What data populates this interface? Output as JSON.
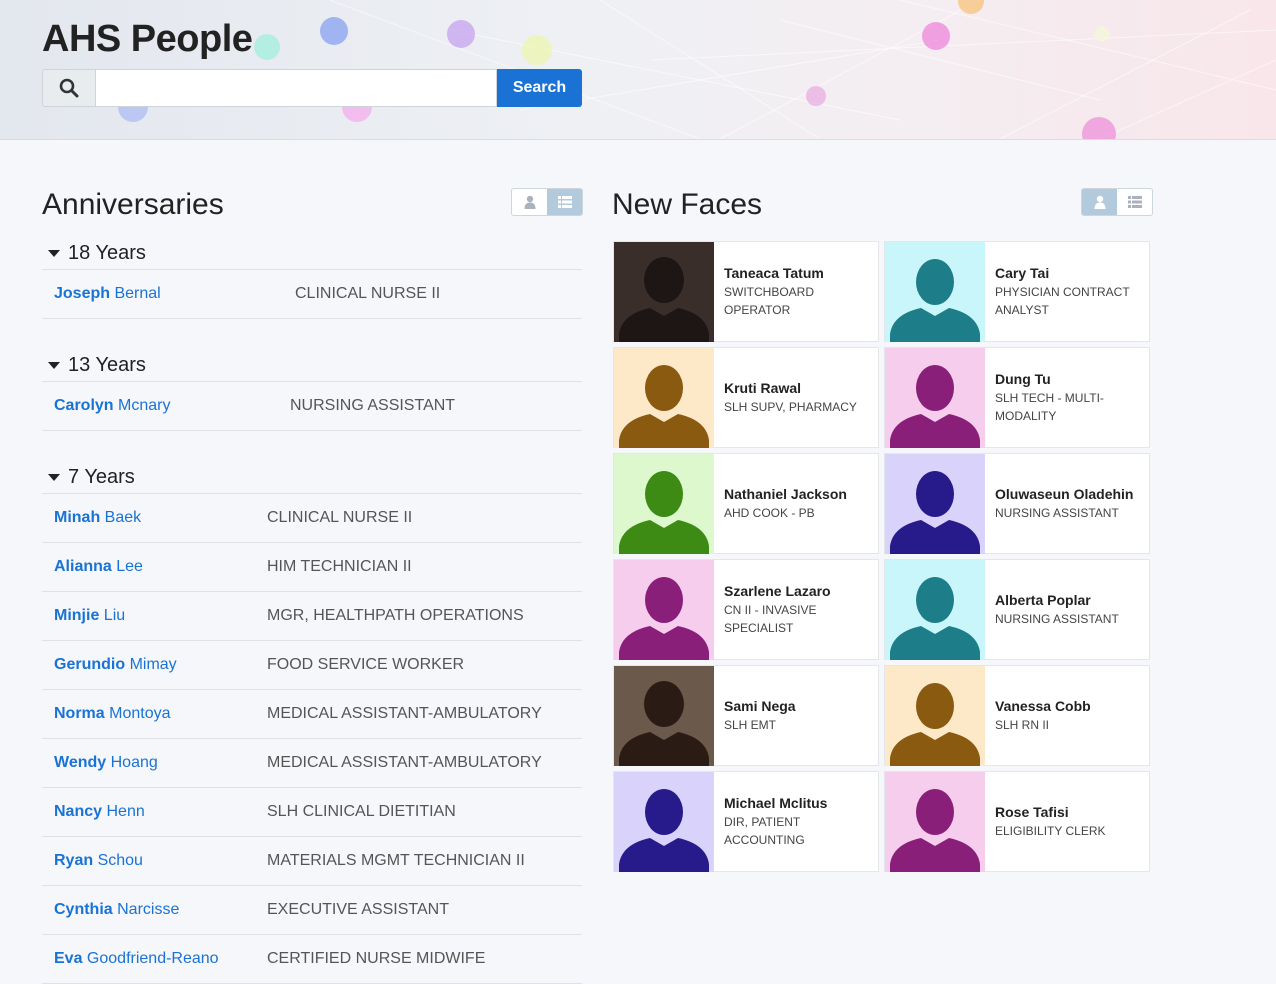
{
  "app": {
    "title": "AHS People",
    "search": {
      "placeholder": "",
      "value": "",
      "button_label": "Search",
      "icon": "search-icon"
    }
  },
  "anniversaries": {
    "title": "Anniversaries",
    "view_toggle": {
      "options": [
        "person-icon",
        "list-icon"
      ],
      "active": "list-icon"
    },
    "groups": [
      {
        "label": "18 Years",
        "people": [
          {
            "first": "Joseph",
            "last": "Bernal",
            "title": "CLINICAL NURSE II"
          }
        ]
      },
      {
        "label": "13 Years",
        "people": [
          {
            "first": "Carolyn",
            "last": "Mcnary",
            "title": "NURSING ASSISTANT"
          }
        ]
      },
      {
        "label": "7 Years",
        "people": [
          {
            "first": "Minah",
            "last": "Baek",
            "title": "CLINICAL NURSE II"
          },
          {
            "first": "Alianna",
            "last": "Lee",
            "title": "HIM TECHNICIAN II"
          },
          {
            "first": "Minjie",
            "last": "Liu",
            "title": "MGR, HEALTHPATH OPERATIONS"
          },
          {
            "first": "Gerundio",
            "last": "Mimay",
            "title": "FOOD SERVICE WORKER"
          },
          {
            "first": "Norma",
            "last": "Montoya",
            "title": "MEDICAL ASSISTANT-AMBULATORY"
          },
          {
            "first": "Wendy",
            "last": "Hoang",
            "title": "MEDICAL ASSISTANT-AMBULATORY"
          },
          {
            "first": "Nancy",
            "last": "Henn",
            "title": "SLH CLINICAL DIETITIAN"
          },
          {
            "first": "Ryan",
            "last": "Schou",
            "title": "MATERIALS MGMT TECHNICIAN II"
          },
          {
            "first": "Cynthia",
            "last": "Narcisse",
            "title": "EXECUTIVE ASSISTANT"
          },
          {
            "first": "Eva",
            "last": "Goodfriend-Reano",
            "title": "CERTIFIED NURSE MIDWIFE"
          }
        ]
      }
    ]
  },
  "new_faces": {
    "title": "New Faces",
    "view_toggle": {
      "options": [
        "person-icon",
        "list-icon"
      ],
      "active": "person-icon"
    },
    "people": [
      {
        "name": "Taneaca Tatum",
        "title": "SWITCHBOARD OPERATOR",
        "photo": "photo",
        "bg": "#3a2e2a",
        "fg": "#1e1614"
      },
      {
        "name": "Cary Tai",
        "title": "PHYSICIAN CONTRACT ANALYST",
        "photo": "silhouette",
        "bg": "#c8f6fa",
        "fg": "#1d7d88"
      },
      {
        "name": "Kruti Rawal",
        "title": "SLH SUPV, PHARMACY",
        "photo": "silhouette",
        "bg": "#fde8c8",
        "fg": "#8a5a10"
      },
      {
        "name": "Dung Tu",
        "title": "SLH TECH - MULTI-MODALITY",
        "photo": "silhouette",
        "bg": "#f7cdee",
        "fg": "#8a1f7a"
      },
      {
        "name": "Nathaniel Jackson",
        "title": "AHD COOK - PB",
        "photo": "silhouette",
        "bg": "#dcf8cc",
        "fg": "#3d8a15"
      },
      {
        "name": "Oluwaseun Oladehin",
        "title": "NURSING ASSISTANT",
        "photo": "silhouette",
        "bg": "#d9d2fa",
        "fg": "#271a8a"
      },
      {
        "name": "Szarlene Lazaro",
        "title": "CN II - INVASIVE SPECIALIST",
        "photo": "silhouette",
        "bg": "#f7cdee",
        "fg": "#8a1f7a"
      },
      {
        "name": "Alberta Poplar",
        "title": "NURSING ASSISTANT",
        "photo": "silhouette",
        "bg": "#c8f6fa",
        "fg": "#1d7d88"
      },
      {
        "name": "Sami Nega",
        "title": "SLH EMT",
        "photo": "photo",
        "bg": "#6b5a4c",
        "fg": "#2a1c14"
      },
      {
        "name": "Vanessa Cobb",
        "title": "SLH RN II",
        "photo": "silhouette",
        "bg": "#fde8c8",
        "fg": "#8a5a10"
      },
      {
        "name": "Michael Mclitus",
        "title": "DIR, PATIENT ACCOUNTING",
        "photo": "silhouette",
        "bg": "#d9d2fa",
        "fg": "#271a8a"
      },
      {
        "name": "Rose Tafisi",
        "title": "ELIGIBILITY CLERK",
        "photo": "silhouette",
        "bg": "#f7cdee",
        "fg": "#8a1f7a"
      }
    ]
  }
}
